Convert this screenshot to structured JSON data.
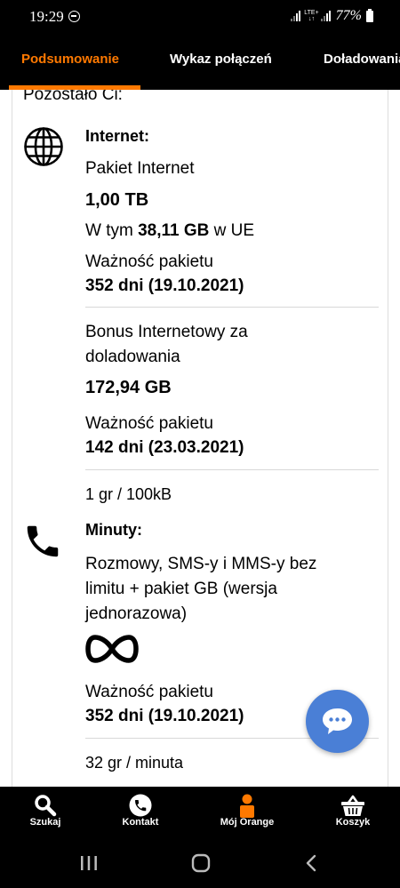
{
  "status_bar": {
    "time": "19:29",
    "network": "LTE+",
    "battery_percent": "77%",
    "battery_icon": "battery-icon"
  },
  "tabs": [
    {
      "label": "Podsumowanie",
      "active": true
    },
    {
      "label": "Wykaz połączeń",
      "active": false
    },
    {
      "label": "Doładowania",
      "active": false
    }
  ],
  "colors": {
    "accent": "#ff7900",
    "fab": "#4a7fd6",
    "background": "#ffffff",
    "bars": "#000000"
  },
  "remaining_header": "Pozostało Ci:",
  "internet": {
    "title": "Internet:",
    "icon": "globe-icon",
    "package_name": "Pakiet Internet",
    "amount": "1,00 TB",
    "eu_prefix": "W tym",
    "eu_amount": "38,11 GB",
    "eu_suffix": "w UE",
    "validity_label": "Ważność pakietu",
    "validity_value": "352 dni (19.10.2021)",
    "bonus_line1": "Bonus Internetowy za",
    "bonus_line2": "doladowania",
    "bonus_amount": "172,94 GB",
    "bonus_validity_label": "Ważność pakietu",
    "bonus_validity_value": "142 dni (23.03.2021)",
    "rate": "1 gr / 100kB"
  },
  "minutes": {
    "title": "Minuty:",
    "icon": "phone-icon",
    "desc_line1": "Rozmowy, SMS-y i MMS-y bez",
    "desc_line2": "limitu + pakiet GB (wersja",
    "desc_line3": "jednorazowa)",
    "amount_icon": "infinity-icon",
    "validity_label": "Ważność pakietu",
    "validity_value": "352 dni (19.10.2021)",
    "rate": "32 gr / minuta"
  },
  "chat_button": {
    "icon": "chat-bubble-icon"
  },
  "bottom_nav": [
    {
      "label": "Szukaj",
      "icon": "search-icon"
    },
    {
      "label": "Kontakt",
      "icon": "phone-circle-icon"
    },
    {
      "label": "Mój Orange",
      "icon": "user-icon"
    },
    {
      "label": "Koszyk",
      "icon": "basket-icon"
    }
  ],
  "system_nav": [
    "recent-apps-icon",
    "home-icon",
    "back-icon"
  ]
}
